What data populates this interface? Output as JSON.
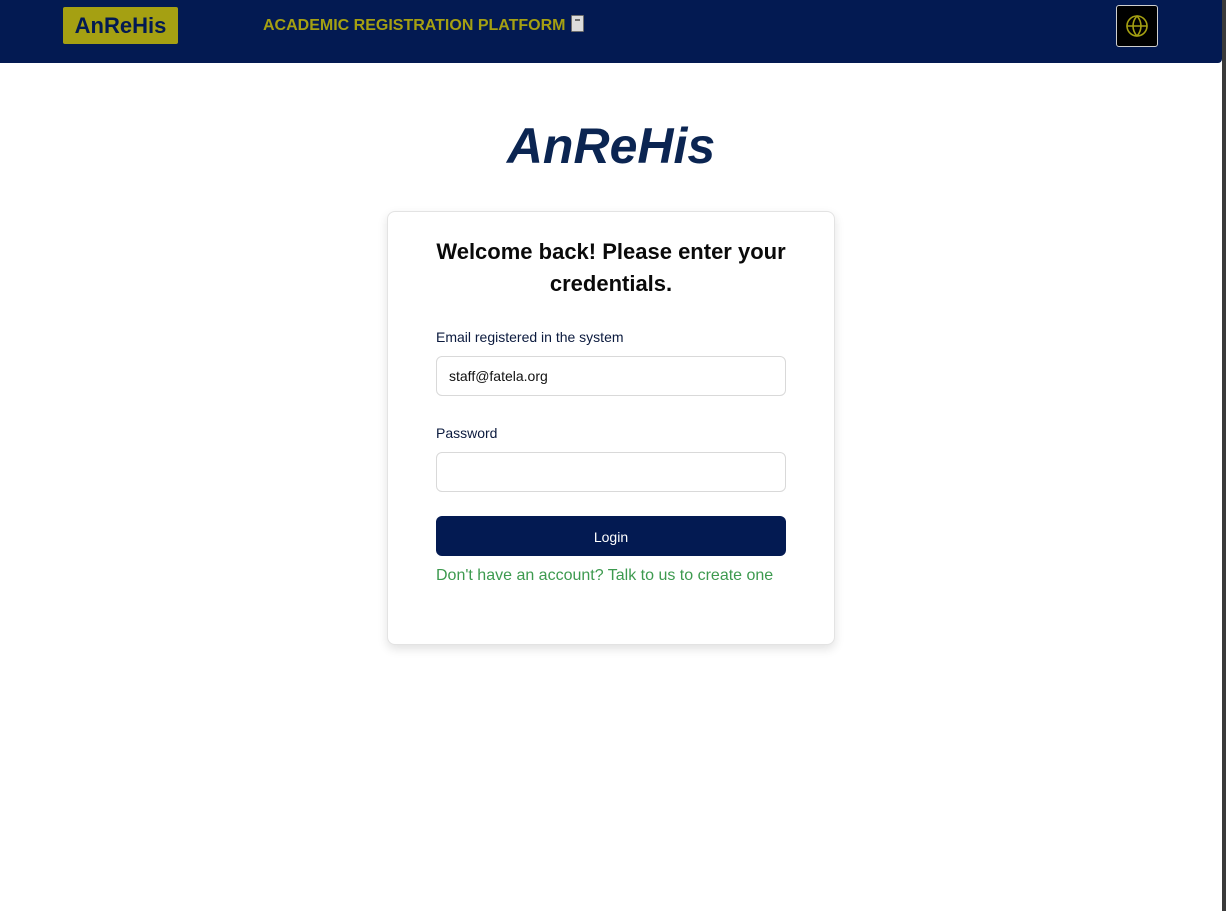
{
  "header": {
    "brand": "AnReHis",
    "platform_title": "ACADEMIC REGISTRATION PLATFORM",
    "platform_icon": "notebook-icon",
    "language_icon": "globe-icon"
  },
  "main": {
    "app_heading": "AnReHis"
  },
  "login_card": {
    "title": "Welcome back! Please enter your credentials.",
    "email_label": "Email registered in the system",
    "email_value": "staff@fatela.org",
    "password_label": "Password",
    "password_value": "",
    "login_button": "Login",
    "signup_link": "Don't have an account? Talk to us to create one"
  },
  "colors": {
    "header_bg": "#031a52",
    "brand_accent": "#a5a012",
    "heading_text": "#0b2552",
    "link_green": "#3d9a4f"
  }
}
